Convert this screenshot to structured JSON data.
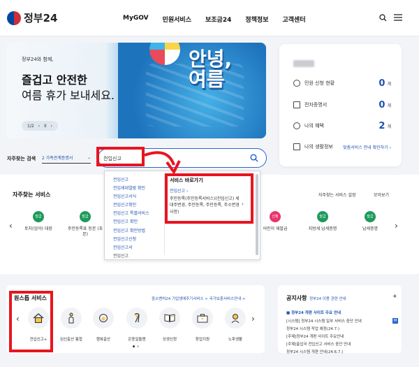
{
  "header": {
    "logo_text": "정부24",
    "nav": [
      "MyGOV",
      "민원서비스",
      "보조금24",
      "정책정보",
      "고객센터"
    ],
    "icons": [
      "search-icon",
      "menu-icon"
    ]
  },
  "banner": {
    "small_text": "정부24와 함께,",
    "title_line1": "즐겁고 안전한",
    "title_line2": "여름 휴가 보내세요.",
    "hello_text": "안녕,",
    "summer_text": "여름",
    "pager": "1/2",
    "pager_prev": "‹",
    "pager_play": "II",
    "pager_next": "›"
  },
  "user_card": {
    "rows": [
      {
        "label": "민원 신청 현황",
        "count": "0",
        "unit": "개"
      },
      {
        "label": "전자증명서",
        "count": "0",
        "unit": "개"
      },
      {
        "label": "나의 혜택",
        "count": "2",
        "unit": "개"
      }
    ],
    "life_label": "나의 생활정보",
    "life_link": "맞춤서비스 안내 확인하기 ›"
  },
  "search": {
    "freq_label": "자주찾는 검색",
    "freq_selected": "2 가족관계증명서",
    "query": "전입신고"
  },
  "autocomplete": {
    "suggestions": [
      "전입신고",
      "전입세대열람 확인",
      "전입신고서식",
      "전입신고확인",
      "전입신고 특별서비스",
      "전입신고 확인",
      "전입신고 확인방법",
      "전입신고신청",
      "전입신고서",
      "전입신고"
    ],
    "shortcut_title": "서비스 바로가기",
    "shortcut_link": "전입신고 ›",
    "shortcut_desc": "주민등록(주민등록서비스)(전입신고) 세대주변경, 주민등록, 주민등록, 주소변경사항)",
    "shortcut_chevron": "›"
  },
  "services": {
    "title": "자주찾는 서비스",
    "settings": "자주찾는 서비스 설정",
    "view_all": "모아보기",
    "items": [
      {
        "badge": "발급",
        "caption": "토지(임야) 대장"
      },
      {
        "badge": "발급",
        "caption": "주민등록표 등본 (초본)"
      },
      {
        "badge": "신청",
        "caption": "어린이 재발급"
      },
      {
        "badge": "발급",
        "caption": "지방세 납세증명"
      },
      {
        "badge": "발급",
        "caption": "납세증명"
      }
    ],
    "prev": "‹",
    "next": "›"
  },
  "onestop": {
    "title": "원스톱 서비스",
    "links": "중소벤처24 기업생애주기서비스 >   국가보훈서비스안내 >",
    "items": [
      "전입신고+",
      "임신출산 통합",
      "행복출산",
      "온종일돌봄",
      "상생신청",
      "창업지원",
      "노후생활"
    ],
    "prev": "‹",
    "next": "›"
  },
  "notice": {
    "title": "공지사항",
    "subtitle": "정부24 이용 관련 안내",
    "more": "+",
    "items": [
      "■ 정부24 개편 사이트 주요 안내",
      "[시스템] 정부24 시스템 일부 서비스 중단 안내",
      "정부24 시스템 작업 예정(24.7.)",
      "[주제]정부24 개편 사이트 주요안내",
      "[주제]출입국 전입신고 서비스 중단 안내",
      "정부24 시스템 개편 안내(24.6.7.)"
    ]
  },
  "colors": {
    "accent": "#2767d2",
    "annotation": "#e8141f",
    "badge_green": "#1d9a5a"
  }
}
